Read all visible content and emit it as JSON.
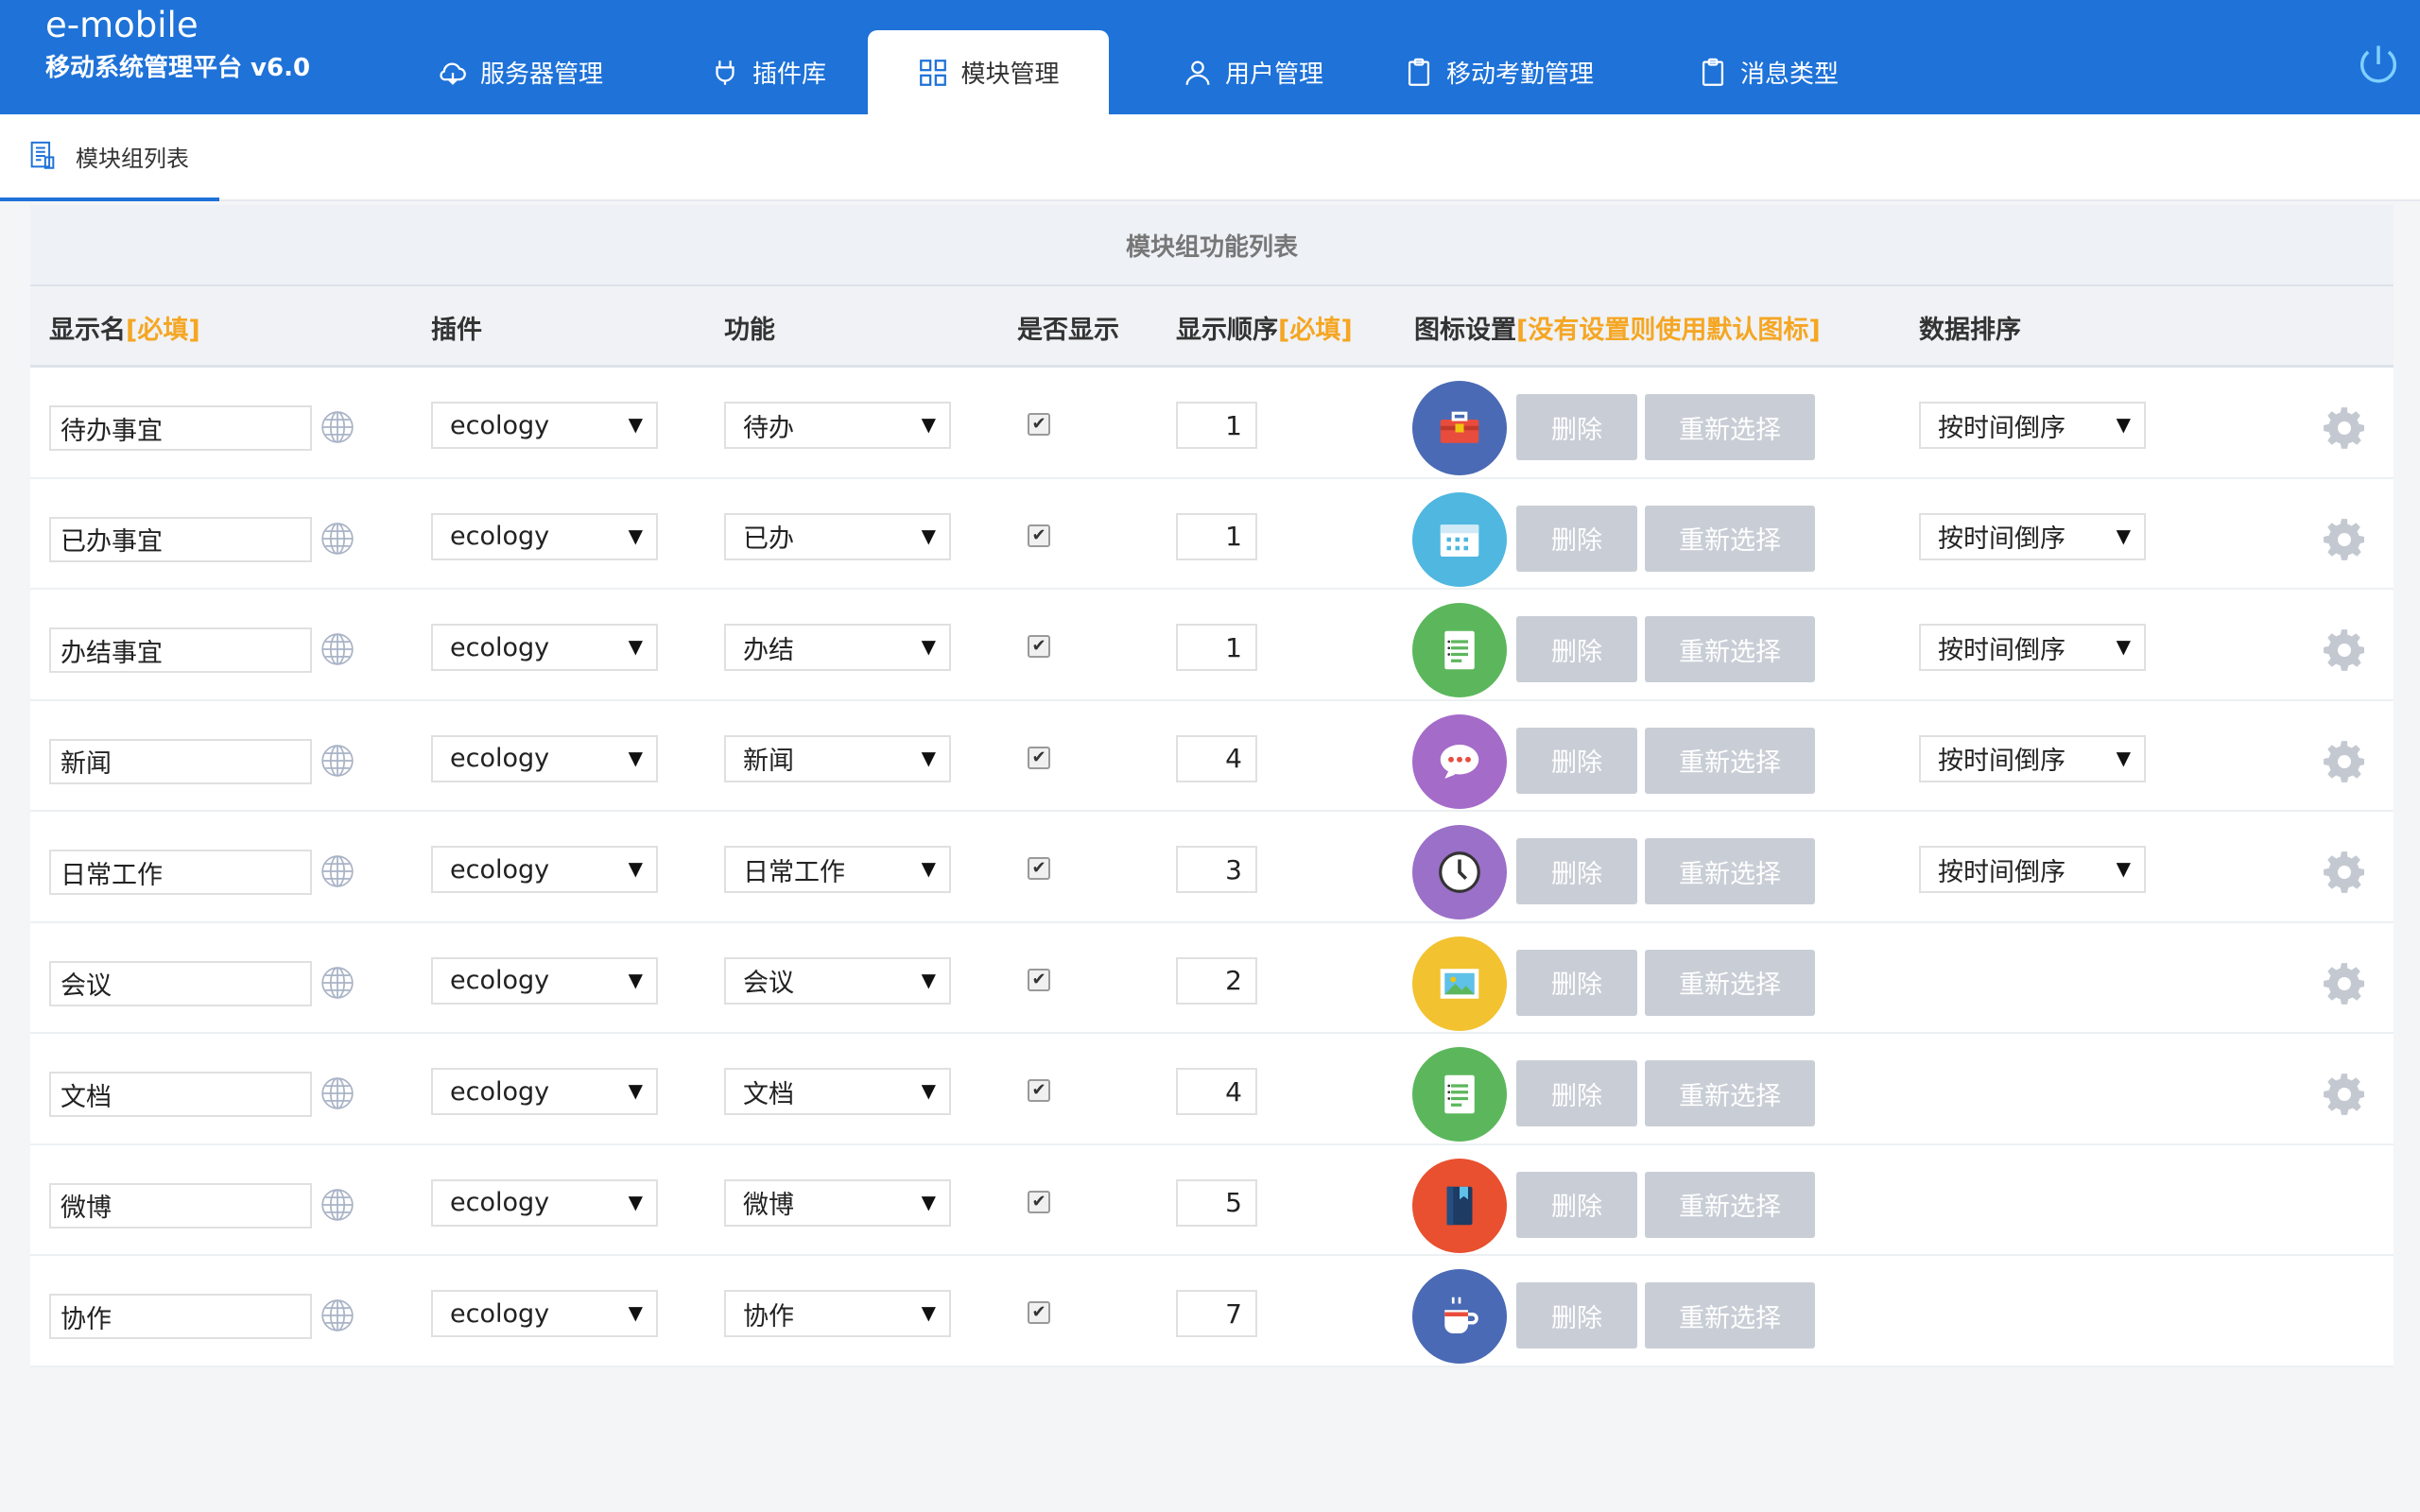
{
  "header": {
    "brand_title": "e-mobile",
    "brand_subtitle": "移动系统管理平台 v6.0",
    "nav": [
      {
        "label": "服务器管理",
        "icon": "cloud-icon"
      },
      {
        "label": "插件库",
        "icon": "plug-icon"
      },
      {
        "label": "模块管理",
        "icon": "modules-icon",
        "active": true
      },
      {
        "label": "用户管理",
        "icon": "user-icon"
      },
      {
        "label": "移动考勤管理",
        "icon": "clipboard-icon"
      },
      {
        "label": "消息类型",
        "icon": "clipboard-icon"
      }
    ],
    "power_icon": "power-icon"
  },
  "subnav": {
    "tab_label": "模块组列表",
    "tab_icon": "list-doc-icon"
  },
  "table": {
    "title": "模块组功能列表",
    "headers": {
      "display_name": "显示名",
      "display_name_req": "[必填]",
      "plugin": "插件",
      "function": "功能",
      "visible": "是否显示",
      "order": "显示顺序",
      "order_req": "[必填]",
      "icon": "图标设置",
      "icon_note": "[没有设置则使用默认图标]",
      "sort": "数据排序"
    },
    "buttons": {
      "delete": "删除",
      "reselect": "重新选择"
    },
    "rows": [
      {
        "name": "待办事宜",
        "plugin": "ecology",
        "func": "待办",
        "visible": true,
        "order": "1",
        "icon": "toolbox-icon",
        "icon_color": "#4a6ab5",
        "sort": "按时间倒序",
        "gear": true
      },
      {
        "name": "已办事宜",
        "plugin": "ecology",
        "func": "已办",
        "visible": true,
        "order": "1",
        "icon": "calendar-icon",
        "icon_color": "#4fb7e0",
        "sort": "按时间倒序",
        "gear": true
      },
      {
        "name": "办结事宜",
        "plugin": "ecology",
        "func": "办结",
        "visible": true,
        "order": "1",
        "icon": "notepad-icon",
        "icon_color": "#5cb75c",
        "sort": "按时间倒序",
        "gear": true
      },
      {
        "name": "新闻",
        "plugin": "ecology",
        "func": "新闻",
        "visible": true,
        "order": "4",
        "icon": "chat-bubble-icon",
        "icon_color": "#a46bc9",
        "sort": "按时间倒序",
        "gear": true
      },
      {
        "name": "日常工作",
        "plugin": "ecology",
        "func": "日常工作",
        "visible": true,
        "order": "3",
        "icon": "clock-icon",
        "icon_color": "#9b70c8",
        "sort": "按时间倒序",
        "gear": true
      },
      {
        "name": "会议",
        "plugin": "ecology",
        "func": "会议",
        "visible": true,
        "order": "2",
        "icon": "picture-icon",
        "icon_color": "#f2c230",
        "sort": "",
        "gear": true
      },
      {
        "name": "文档",
        "plugin": "ecology",
        "func": "文档",
        "visible": true,
        "order": "4",
        "icon": "notepad-icon",
        "icon_color": "#5cb75c",
        "sort": "",
        "gear": true
      },
      {
        "name": "微博",
        "plugin": "ecology",
        "func": "微博",
        "visible": true,
        "order": "5",
        "icon": "book-icon",
        "icon_color": "#e8502f",
        "sort": "",
        "gear": false
      },
      {
        "name": "协作",
        "plugin": "ecology",
        "func": "协作",
        "visible": true,
        "order": "7",
        "icon": "cup-icon",
        "icon_color": "#4a6ab5",
        "sort": "",
        "gear": false
      }
    ]
  }
}
